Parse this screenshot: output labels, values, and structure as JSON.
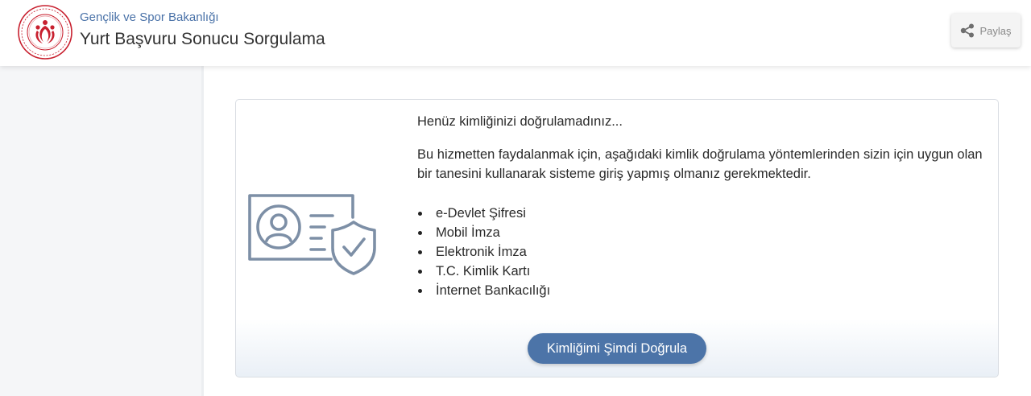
{
  "header": {
    "ministry": "Gençlik ve Spor Bakanlığı",
    "title": "Yurt Başvuru Sonucu Sorgulama",
    "share_label": "Paylaş",
    "logo_icon": "ministry-logo-icon",
    "share_icon": "share-icon"
  },
  "card": {
    "heading": "Henüz kimliğinizi doğrulamadınız...",
    "description": "Bu hizmetten faydalanmak için, aşağıdaki kimlik doğrulama yöntemlerinden sizin için uygun olan bir tanesini kullanarak sisteme giriş yapmış olmanız gerekmektedir.",
    "methods": [
      "e-Devlet Şifresi",
      "Mobil İmza",
      "Elektronik İmza",
      "T.C. Kimlik Kartı",
      "İnternet Bankacılığı"
    ],
    "verify_button": "Kimliğimi Şimdi Doğrula",
    "illustration_icon": "id-card-shield-icon"
  },
  "colors": {
    "accent": "#4c74a8",
    "logo_red": "#c8202f",
    "illustration": "#7d8fa6",
    "sidebar_bg": "#f5f6f8"
  }
}
